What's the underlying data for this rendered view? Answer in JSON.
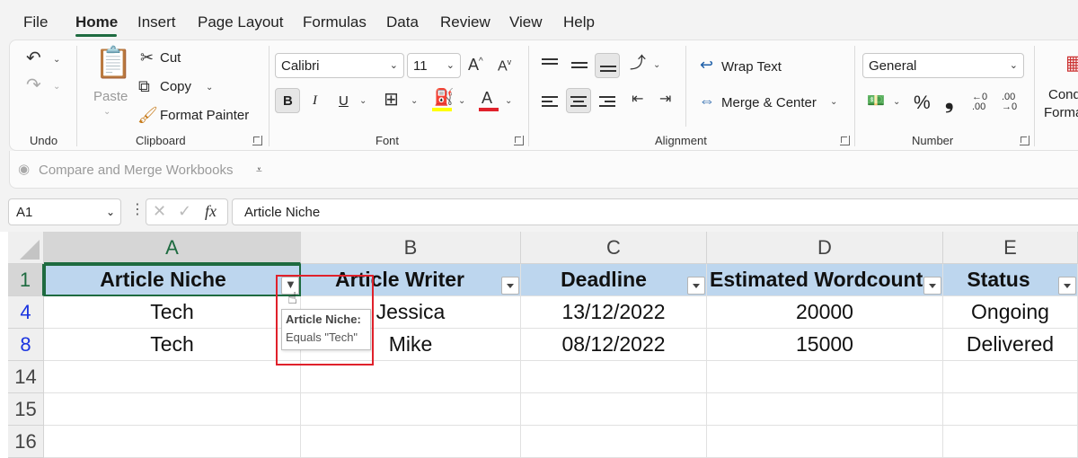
{
  "menu": {
    "tabs": [
      "File",
      "Home",
      "Insert",
      "Page Layout",
      "Formulas",
      "Data",
      "Review",
      "View",
      "Help"
    ],
    "active_tab": "Home"
  },
  "ribbon": {
    "undo": {
      "group_label": "Undo"
    },
    "clipboard": {
      "paste_label": "Paste",
      "cut_label": "Cut",
      "copy_label": "Copy",
      "format_painter_label": "Format Painter",
      "group_label": "Clipboard"
    },
    "font": {
      "font_name": "Calibri",
      "font_size": "11",
      "bold": "B",
      "italic": "I",
      "underline": "U",
      "group_label": "Font",
      "highlight_color": "#ffff00",
      "font_color": "#e0212b"
    },
    "alignment": {
      "wrap_text_label": "Wrap Text",
      "merge_center_label": "Merge & Center",
      "group_label": "Alignment"
    },
    "number": {
      "format": "General",
      "percent": "%",
      "comma": "❟",
      "group_label": "Number"
    },
    "styles": {
      "conditional_label_1": "Cond",
      "conditional_label_2": "Forma"
    }
  },
  "qat": {
    "compare_merge_label": "Compare and Merge Workbooks"
  },
  "formula_bar": {
    "name_box": "A1",
    "fx": "fx",
    "content": "Article Niche"
  },
  "sheet": {
    "columns": [
      "A",
      "B",
      "C",
      "D",
      "E"
    ],
    "rows": [
      "1",
      "4",
      "8",
      "14",
      "15",
      "16"
    ],
    "header": [
      "Article Niche",
      "Article Writer",
      "Deadline",
      "Estimated Wordcount",
      "Status"
    ],
    "data": [
      [
        "Tech",
        "Jessica",
        "13/12/2022",
        "20000",
        "Ongoing"
      ],
      [
        "Tech",
        "Mike",
        "08/12/2022",
        "15000",
        "Delivered"
      ]
    ]
  },
  "tooltip": {
    "title": "Article Niche:",
    "detail": "Equals \"Tech\""
  },
  "colors": {
    "accent": "#1e6b40",
    "table_header": "#bdd6ee",
    "filtered_row_number": "#1a34e0",
    "highlight_frame": "#e0212b"
  }
}
